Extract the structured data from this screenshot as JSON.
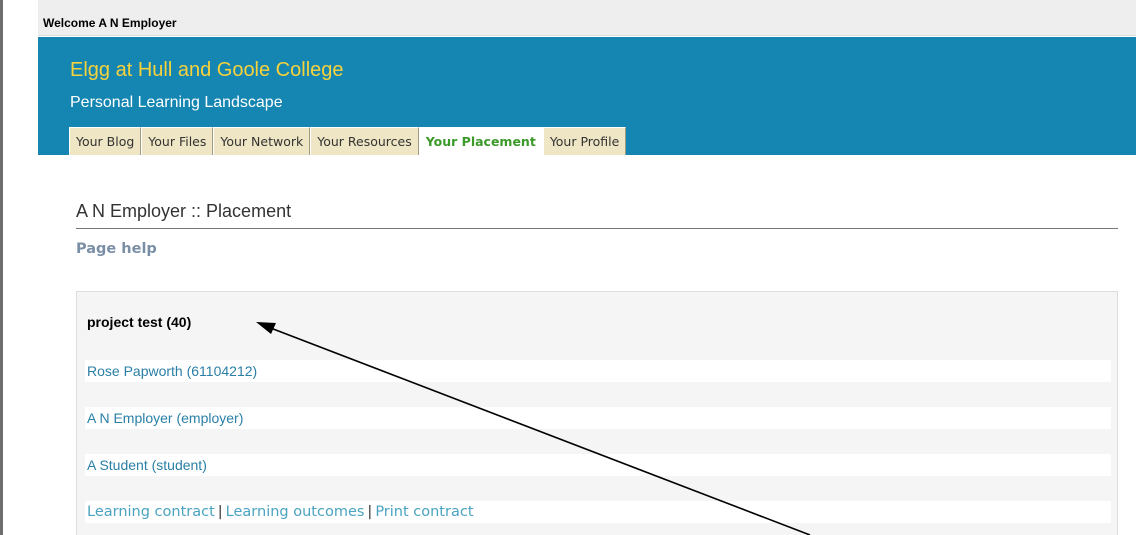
{
  "topbar": {
    "welcome": "Welcome A N Employer"
  },
  "banner": {
    "title": "Elgg at Hull and Goole College",
    "subtitle": "Personal Learning Landscape"
  },
  "tabs": [
    {
      "label": "Your Blog"
    },
    {
      "label": "Your Files"
    },
    {
      "label": "Your Network"
    },
    {
      "label": "Your Resources"
    },
    {
      "label": "Your Placement",
      "active": true
    },
    {
      "label": "Your Profile"
    }
  ],
  "main": {
    "page_title": "A N Employer :: Placement",
    "page_help": "Page help",
    "project": {
      "title": "project test (40)",
      "members": [
        "Rose Papworth (61104212)",
        "A N Employer (employer)",
        "A Student (student)"
      ],
      "links": {
        "learning_contract": "Learning contract",
        "learning_outcomes": "Learning outcomes",
        "print_contract": "Print contract",
        "separator": "|"
      }
    }
  },
  "colors": {
    "banner": "#1586b1",
    "title_yellow": "#f6d23c",
    "tab_bg": "#eee6c4",
    "active_tab_text": "#3b9a2a",
    "link": "#2a7fa6"
  },
  "annotation": {
    "icon": "arrow-pointer-icon"
  }
}
